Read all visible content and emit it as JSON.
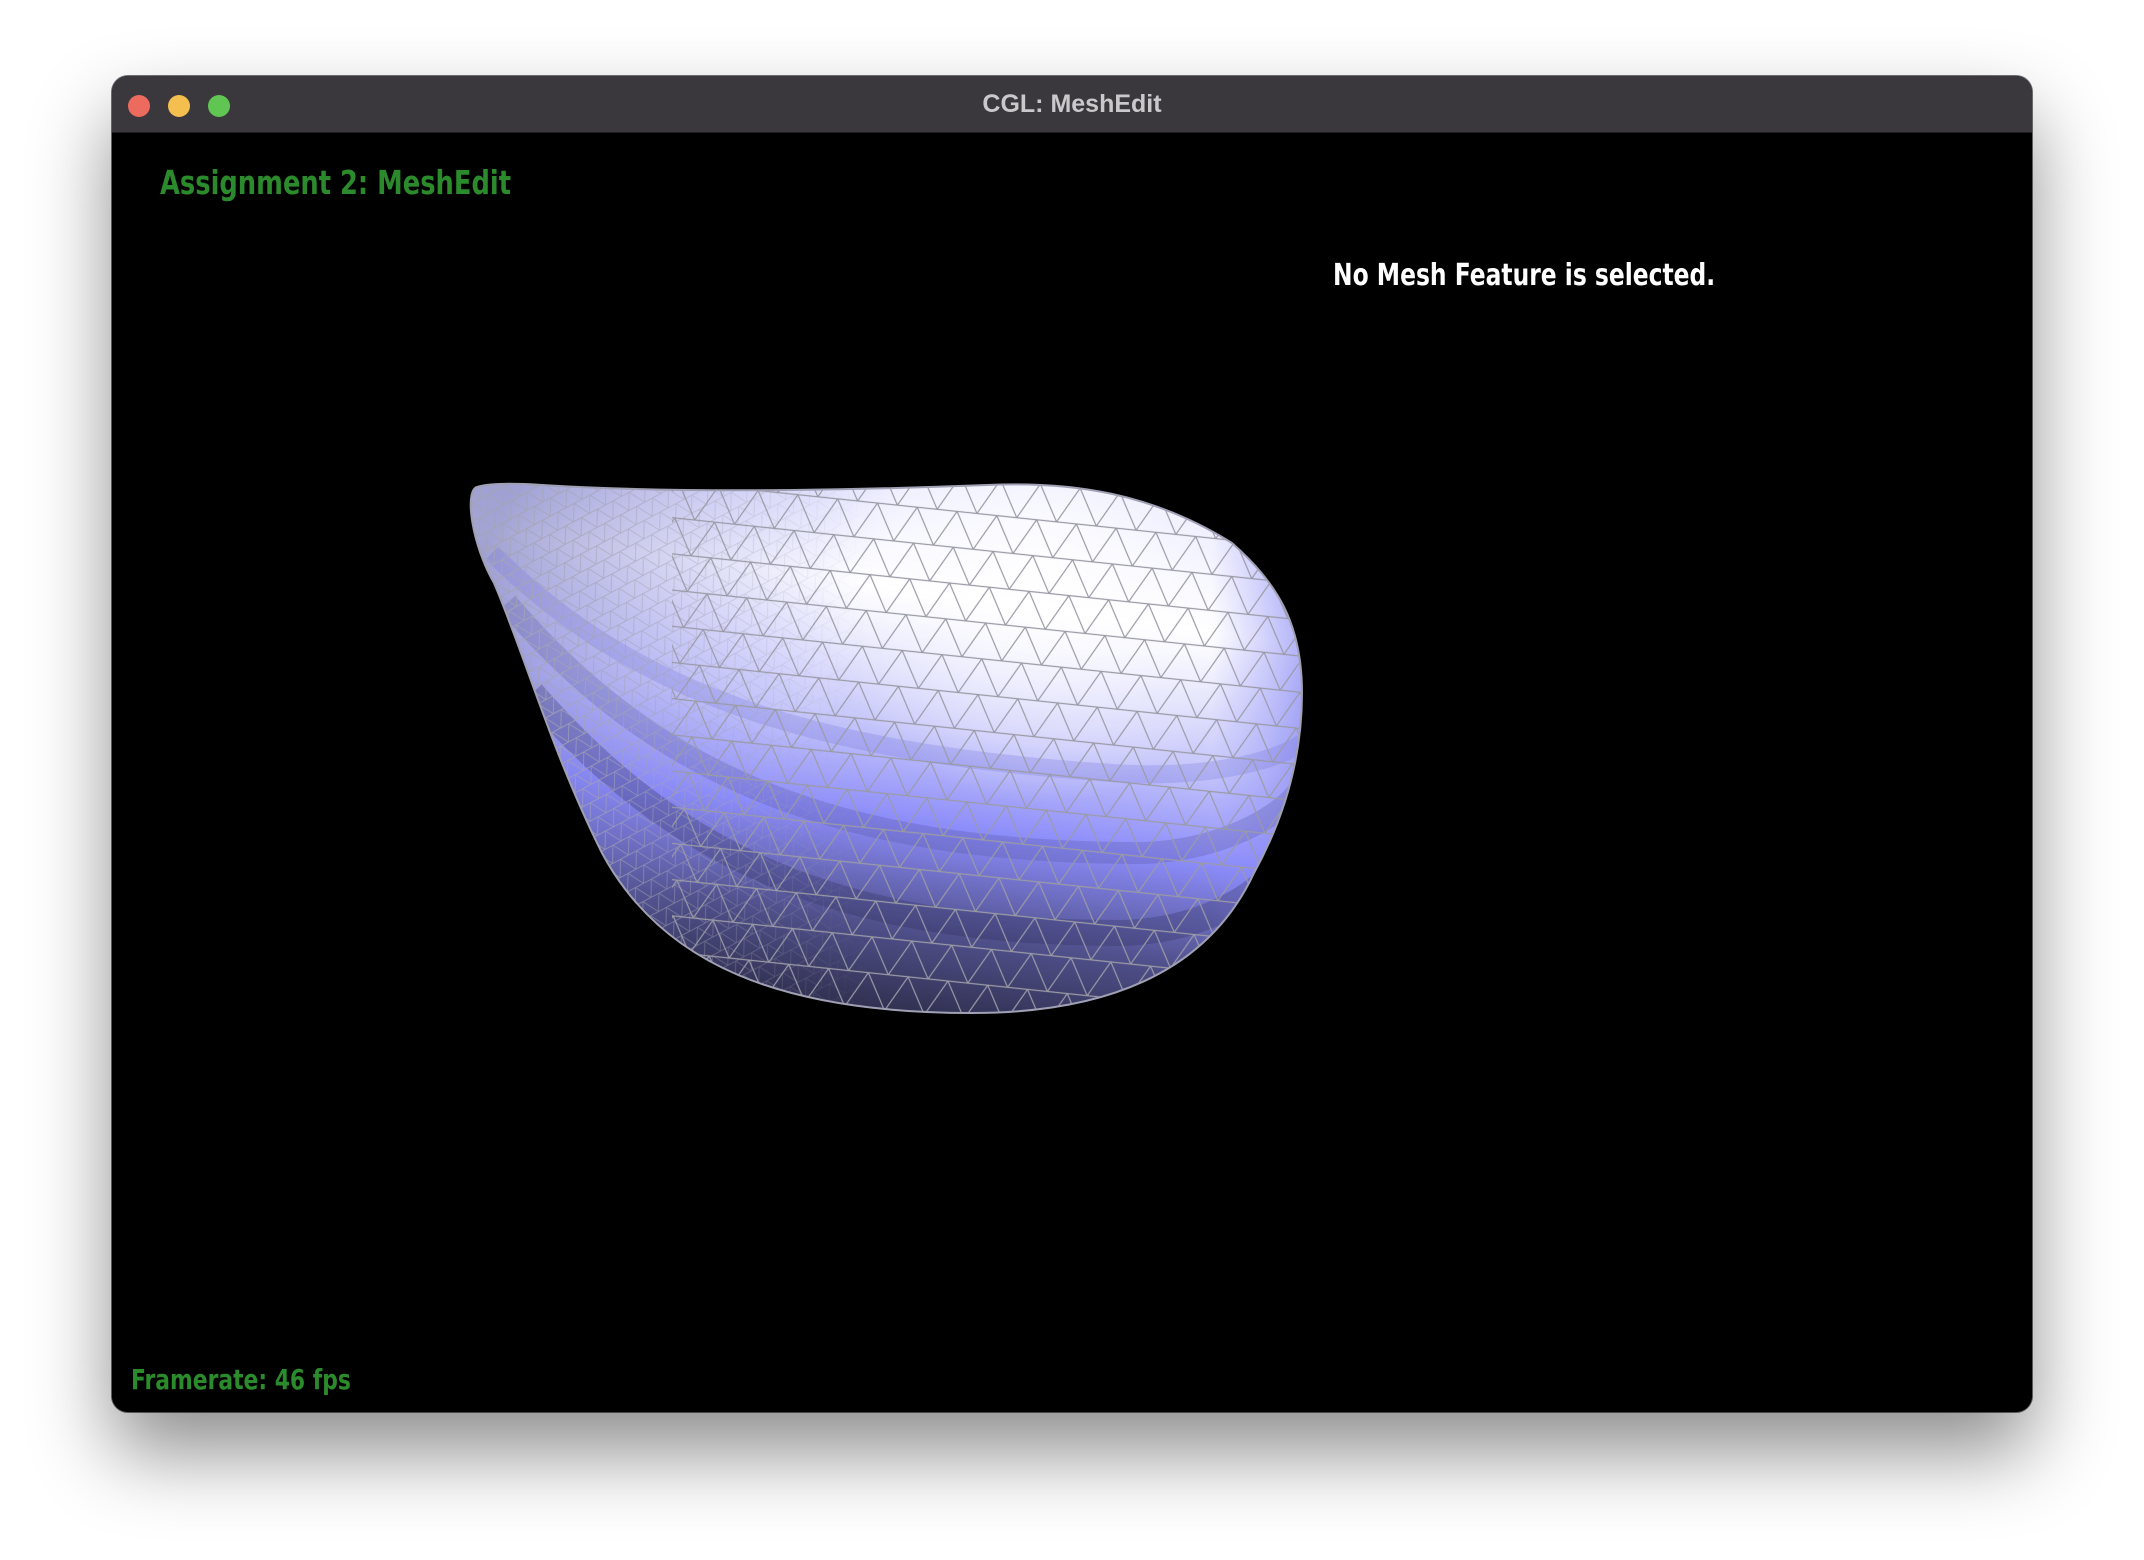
{
  "window": {
    "title": "CGL: MeshEdit"
  },
  "overlay": {
    "heading": "Assignment 2: MeshEdit",
    "selection_status": "No Mesh Feature is selected.",
    "framerate": "Framerate: 46 fps"
  },
  "scene": {
    "mesh_color_light": "#ffffff",
    "mesh_color_mid": "#8c8cfa",
    "mesh_color_dark": "#2a2a48",
    "edge_color": "#9a9aa6",
    "background": "#000000"
  },
  "colors": {
    "overlay_text_green": "#2b8a2b",
    "overlay_text_white": "#ffffff",
    "titlebar": "#3a383c"
  }
}
